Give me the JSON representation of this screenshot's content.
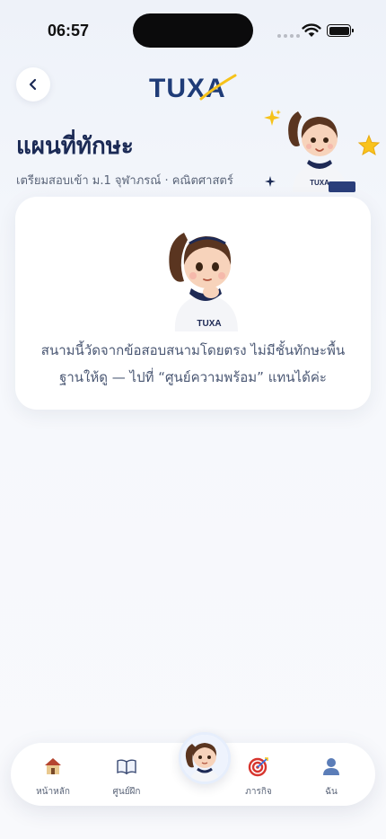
{
  "status_bar": {
    "time": "06:57"
  },
  "header": {
    "back_icon": "chevron-left-icon",
    "logo_text": "TUXA"
  },
  "page": {
    "title": "แผนที่ทักษะ",
    "subtitle": "เตรียมสอบเข้า ม.1 จุฬาภรณ์ · คณิตศาสตร์"
  },
  "card": {
    "message": "สนามนี้วัดจากข้อสอบสนามโดยตรง ไม่มีชั้นทักษะพื้นฐานให้ดู — ไปที่ “ศูนย์ความพร้อม” แทนได้ค่ะ",
    "mascot_shirt_text": "TUXA"
  },
  "mascot_top": {
    "shirt_text": "TUXA"
  },
  "bottom_nav": {
    "items": [
      {
        "label": "หน้าหลัก",
        "icon": "house-icon"
      },
      {
        "label": "ศูนย์ฝึก",
        "icon": "book-icon"
      },
      {
        "label": "",
        "icon": "mascot-avatar"
      },
      {
        "label": "ภารกิจ",
        "icon": "target-icon"
      },
      {
        "label": "ฉัน",
        "icon": "person-icon"
      }
    ]
  },
  "colors": {
    "brand_navy": "#1b2a55",
    "brand_blue": "#2f6fe0",
    "accent_yellow": "#f6c21a",
    "background": "#f6f8fc"
  }
}
